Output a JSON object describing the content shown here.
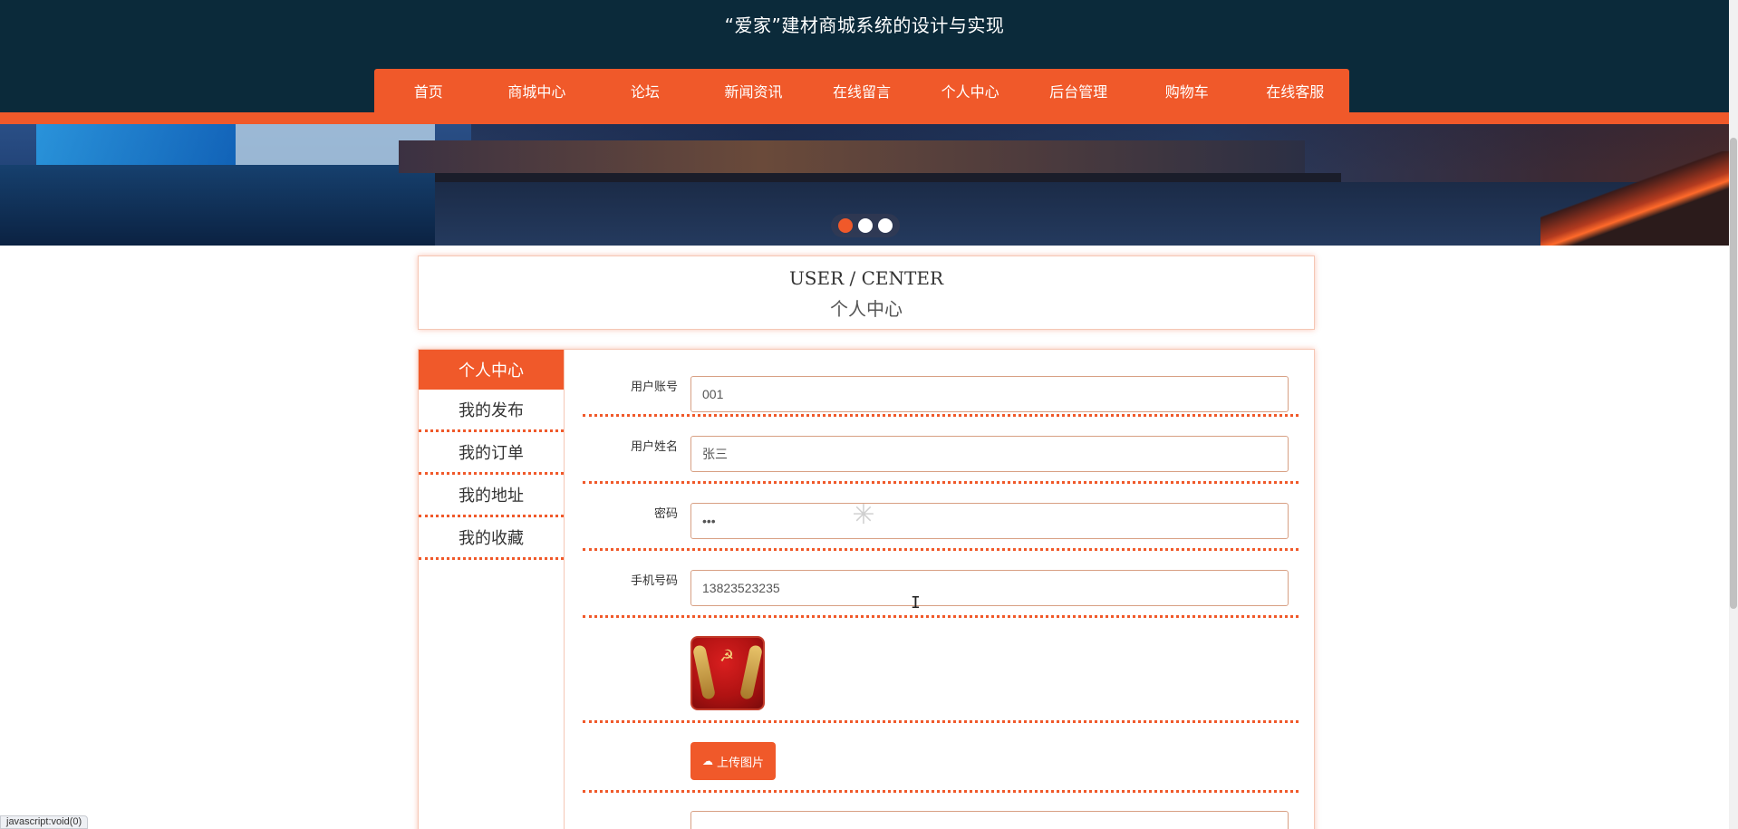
{
  "site": {
    "title": "“爱家”建材商城系统的设计与实现"
  },
  "nav": {
    "items": [
      {
        "label": "首页"
      },
      {
        "label": "商城中心"
      },
      {
        "label": "论坛"
      },
      {
        "label": "新闻资讯"
      },
      {
        "label": "在线留言"
      },
      {
        "label": "个人中心"
      },
      {
        "label": "后台管理"
      },
      {
        "label": "购物车"
      },
      {
        "label": "在线客服"
      }
    ]
  },
  "carousel": {
    "slide_count": 3,
    "active_index": 0
  },
  "center": {
    "title_en": "USER / CENTER",
    "title_zh": "个人中心"
  },
  "sidebar": {
    "items": [
      {
        "label": "个人中心",
        "active": true
      },
      {
        "label": "我的发布"
      },
      {
        "label": "我的订单"
      },
      {
        "label": "我的地址"
      },
      {
        "label": "我的收藏"
      }
    ]
  },
  "form": {
    "account": {
      "label": "用户账号",
      "value": "001"
    },
    "name": {
      "label": "用户姓名",
      "value": "张三"
    },
    "password": {
      "label": "密码",
      "value": "•••"
    },
    "phone": {
      "label": "手机号码",
      "value": "13823523235"
    },
    "upload": {
      "label": "上传图片",
      "icon": "cloud-upload-icon"
    }
  },
  "statusbar": {
    "text": "javascript:void(0)"
  },
  "colors": {
    "accent": "#f0592a",
    "header_bg": "#0b2a3a"
  }
}
